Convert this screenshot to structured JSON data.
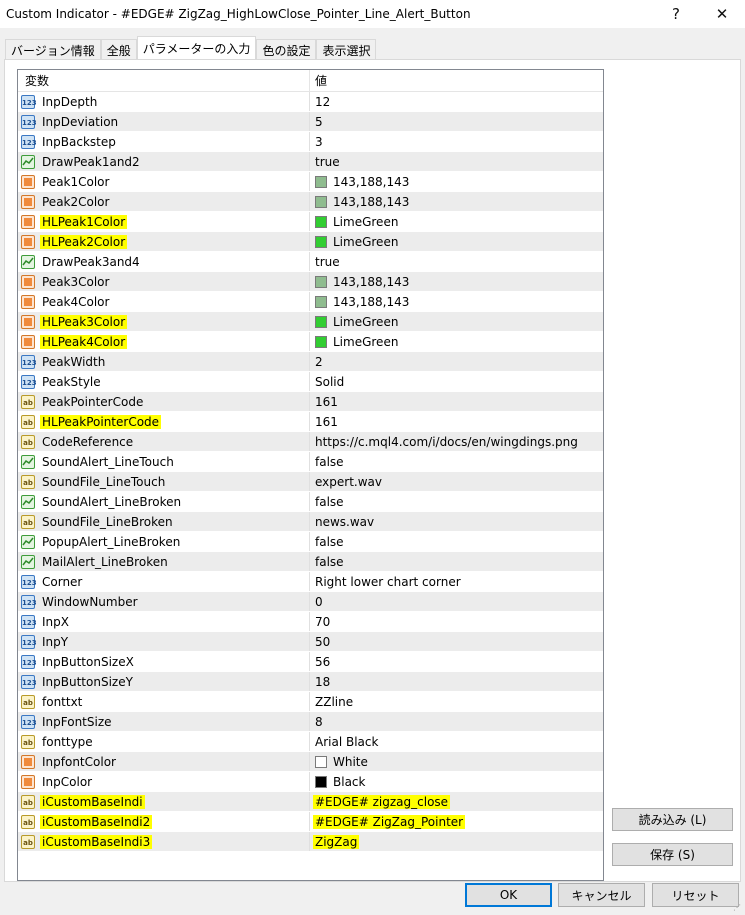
{
  "window": {
    "title": "Custom Indicator - #EDGE# ZigZag_HighLowClose_Pointer_Line_Alert_Button",
    "help": "?",
    "close": "✕"
  },
  "tabs": [
    "バージョン情報",
    "全般",
    "パラメーターの入力",
    "色の設定",
    "表示選択"
  ],
  "active_tab": 2,
  "grid": {
    "col_name": "変数",
    "col_value": "値",
    "rows": [
      {
        "type": "int",
        "name": "InpDepth",
        "value": "12"
      },
      {
        "type": "int",
        "name": "InpDeviation",
        "value": "5"
      },
      {
        "type": "int",
        "name": "InpBackstep",
        "value": "3"
      },
      {
        "type": "bool",
        "name": "DrawPeak1and2",
        "value": "true"
      },
      {
        "type": "color",
        "name": "Peak1Color",
        "value": "143,188,143",
        "swatch": "#8fbc8f"
      },
      {
        "type": "color",
        "name": "Peak2Color",
        "value": "143,188,143",
        "swatch": "#8fbc8f"
      },
      {
        "type": "color",
        "name": "HLPeak1Color",
        "value": "LimeGreen",
        "swatch": "#32cd32",
        "hl_name": true
      },
      {
        "type": "color",
        "name": "HLPeak2Color",
        "value": "LimeGreen",
        "swatch": "#32cd32",
        "hl_name": true
      },
      {
        "type": "bool",
        "name": "DrawPeak3and4",
        "value": "true"
      },
      {
        "type": "color",
        "name": "Peak3Color",
        "value": "143,188,143",
        "swatch": "#8fbc8f"
      },
      {
        "type": "color",
        "name": "Peak4Color",
        "value": "143,188,143",
        "swatch": "#8fbc8f"
      },
      {
        "type": "color",
        "name": "HLPeak3Color",
        "value": "LimeGreen",
        "swatch": "#32cd32",
        "hl_name": true
      },
      {
        "type": "color",
        "name": "HLPeak4Color",
        "value": "LimeGreen",
        "swatch": "#32cd32",
        "hl_name": true
      },
      {
        "type": "int",
        "name": "PeakWidth",
        "value": "2"
      },
      {
        "type": "int",
        "name": "PeakStyle",
        "value": "Solid"
      },
      {
        "type": "str",
        "name": "PeakPointerCode",
        "value": "161"
      },
      {
        "type": "str",
        "name": "HLPeakPointerCode",
        "value": "161",
        "hl_name": true
      },
      {
        "type": "str",
        "name": "CodeReference",
        "value": "https://c.mql4.com/i/docs/en/wingdings.png"
      },
      {
        "type": "bool",
        "name": "SoundAlert_LineTouch",
        "value": "false"
      },
      {
        "type": "str",
        "name": "SoundFile_LineTouch",
        "value": "expert.wav"
      },
      {
        "type": "bool",
        "name": "SoundAlert_LineBroken",
        "value": "false"
      },
      {
        "type": "str",
        "name": "SoundFile_LineBroken",
        "value": "news.wav"
      },
      {
        "type": "bool",
        "name": "PopupAlert_LineBroken",
        "value": "false"
      },
      {
        "type": "bool",
        "name": "MailAlert_LineBroken",
        "value": "false"
      },
      {
        "type": "int",
        "name": "Corner",
        "value": "Right lower chart corner"
      },
      {
        "type": "int",
        "name": "WindowNumber",
        "value": "0"
      },
      {
        "type": "int",
        "name": "InpX",
        "value": "70"
      },
      {
        "type": "int",
        "name": "InpY",
        "value": "50"
      },
      {
        "type": "int",
        "name": "InpButtonSizeX",
        "value": "56"
      },
      {
        "type": "int",
        "name": "InpButtonSizeY",
        "value": "18"
      },
      {
        "type": "str",
        "name": "fonttxt",
        "value": "ZZline"
      },
      {
        "type": "int",
        "name": "InpFontSize",
        "value": "8"
      },
      {
        "type": "str",
        "name": "fonttype",
        "value": "Arial Black"
      },
      {
        "type": "color",
        "name": "InpfontColor",
        "value": "White",
        "swatch": "#ffffff"
      },
      {
        "type": "color",
        "name": "InpColor",
        "value": "Black",
        "swatch": "#000000"
      },
      {
        "type": "str",
        "name": "iCustomBaseIndi",
        "value": "#EDGE# zigzag_close",
        "hl_name": true,
        "hl_value": true
      },
      {
        "type": "str",
        "name": "iCustomBaseIndi2",
        "value": "#EDGE# ZigZag_Pointer",
        "hl_name": true,
        "hl_value": true
      },
      {
        "type": "str",
        "name": "iCustomBaseIndi3",
        "value": "ZigZag",
        "hl_name": true,
        "hl_value": true
      }
    ]
  },
  "type_icons": {
    "int": "123",
    "bool": "",
    "str": "ab",
    "color": ""
  },
  "buttons": {
    "load": "読み込み (L)",
    "save": "保存 (S)",
    "ok": "OK",
    "cancel": "キャンセル",
    "reset": "リセット"
  }
}
